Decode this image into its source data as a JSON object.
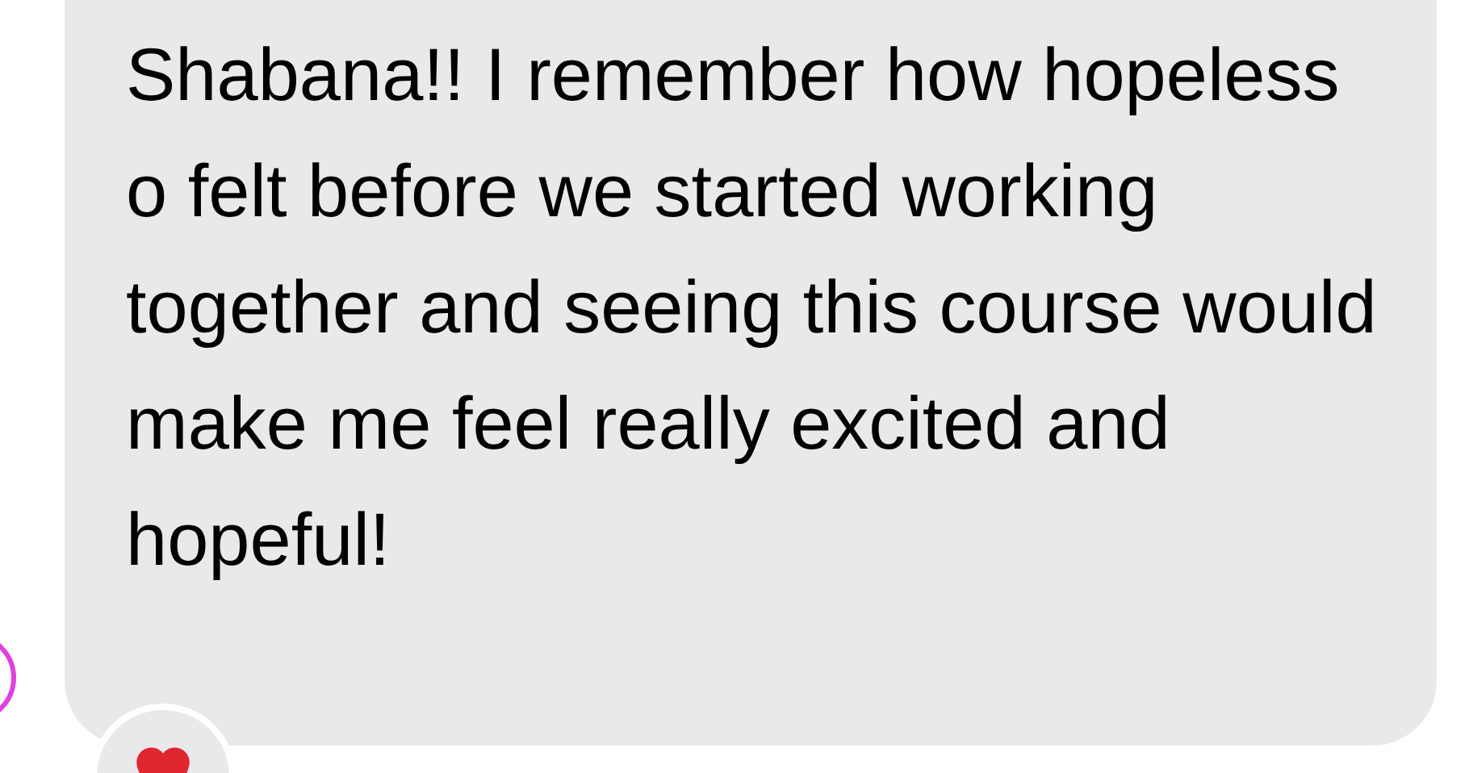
{
  "message": {
    "text": "Shabana!! I remember how hopeless o felt before we started working together and seeing this course would make me feel really excited and hopeful!"
  }
}
